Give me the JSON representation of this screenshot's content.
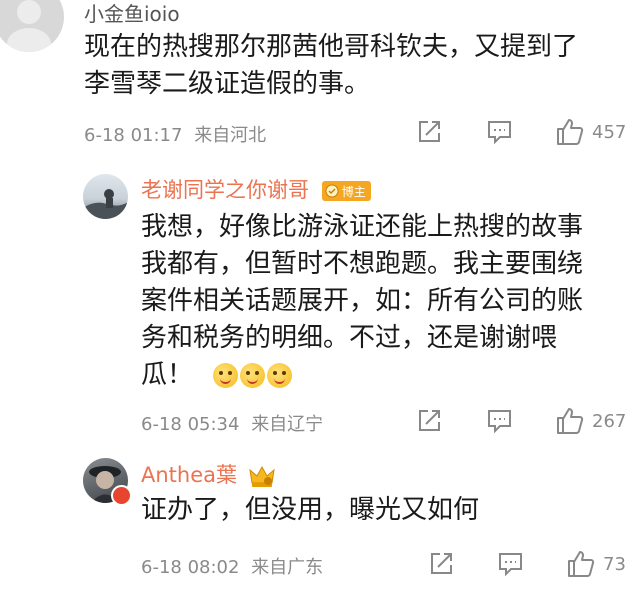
{
  "comments": [
    {
      "username": "小金鱼ioio",
      "lines": [
        "现在的热搜那尔那茜他哥科钦夫，又提到了",
        "李雪琴二级证造假的事。"
      ],
      "date": "6-18 01:17",
      "location": "来自河北",
      "likes": "457"
    },
    {
      "username": "老谢同学之你谢哥",
      "badge": "博主",
      "lines": [
        "我想，好像比游泳证还能上热搜的故事",
        "我都有，但暂时不想跑题。我主要围绕",
        "案件相关话题展开，如：所有公司的账",
        "务和税务的明细。不过，还是谢谢喂",
        "瓜！"
      ],
      "emojis": [
        "laugh-emoji",
        "laugh-emoji",
        "laugh-emoji"
      ],
      "date": "6-18 05:34",
      "location": "来自辽宁",
      "likes": "267"
    },
    {
      "username": "Anthea葉",
      "lines": [
        "证办了，但没用，曝光又如何"
      ],
      "date": "6-18 08:02",
      "location": "来自广东",
      "likes": "73"
    }
  ],
  "icons": {
    "share": "share-icon",
    "reply": "comment-icon",
    "like": "thumbs-up-icon"
  },
  "colors": {
    "accent": "#eb7350",
    "meta": "#8a8a8a",
    "badge": "#f5a623"
  }
}
